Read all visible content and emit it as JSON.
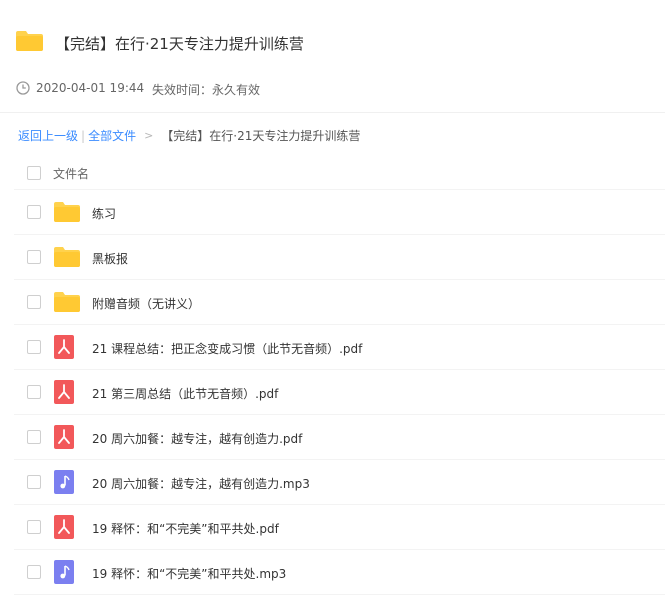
{
  "header": {
    "title": "【完结】在行·21天专注力提升训练营",
    "folder_icon": "folder-icon"
  },
  "meta": {
    "date": "2020-04-01 19:44",
    "expire": "失效时间：永久有效",
    "clock_icon": "clock-icon"
  },
  "breadcrumb": {
    "back": "返回上一级",
    "separator": "|",
    "all_files": "全部文件",
    "arrow": ">",
    "current": "【完结】在行·21天专注力提升训练营"
  },
  "list": {
    "header_label": "文件名",
    "items": [
      {
        "name": "练习",
        "type": "folder"
      },
      {
        "name": "黑板报",
        "type": "folder"
      },
      {
        "name": "附赠音频（无讲义）",
        "type": "folder"
      },
      {
        "name": "21 课程总结：把正念变成习惯（此节无音频）.pdf",
        "type": "pdf"
      },
      {
        "name": "21 第三周总结（此节无音频）.pdf",
        "type": "pdf"
      },
      {
        "name": "20 周六加餐：越专注，越有创造力.pdf",
        "type": "pdf"
      },
      {
        "name": "20 周六加餐：越专注，越有创造力.mp3",
        "type": "mp3"
      },
      {
        "name": "19 释怀：和“不完美”和平共处.pdf",
        "type": "pdf"
      },
      {
        "name": "19 释怀：和“不完美”和平共处.mp3",
        "type": "mp3"
      }
    ]
  },
  "colors": {
    "folder": "#ffd24d",
    "pdf": "#f2585a",
    "mp3": "#7b7ff0",
    "link": "#3b8cff"
  }
}
